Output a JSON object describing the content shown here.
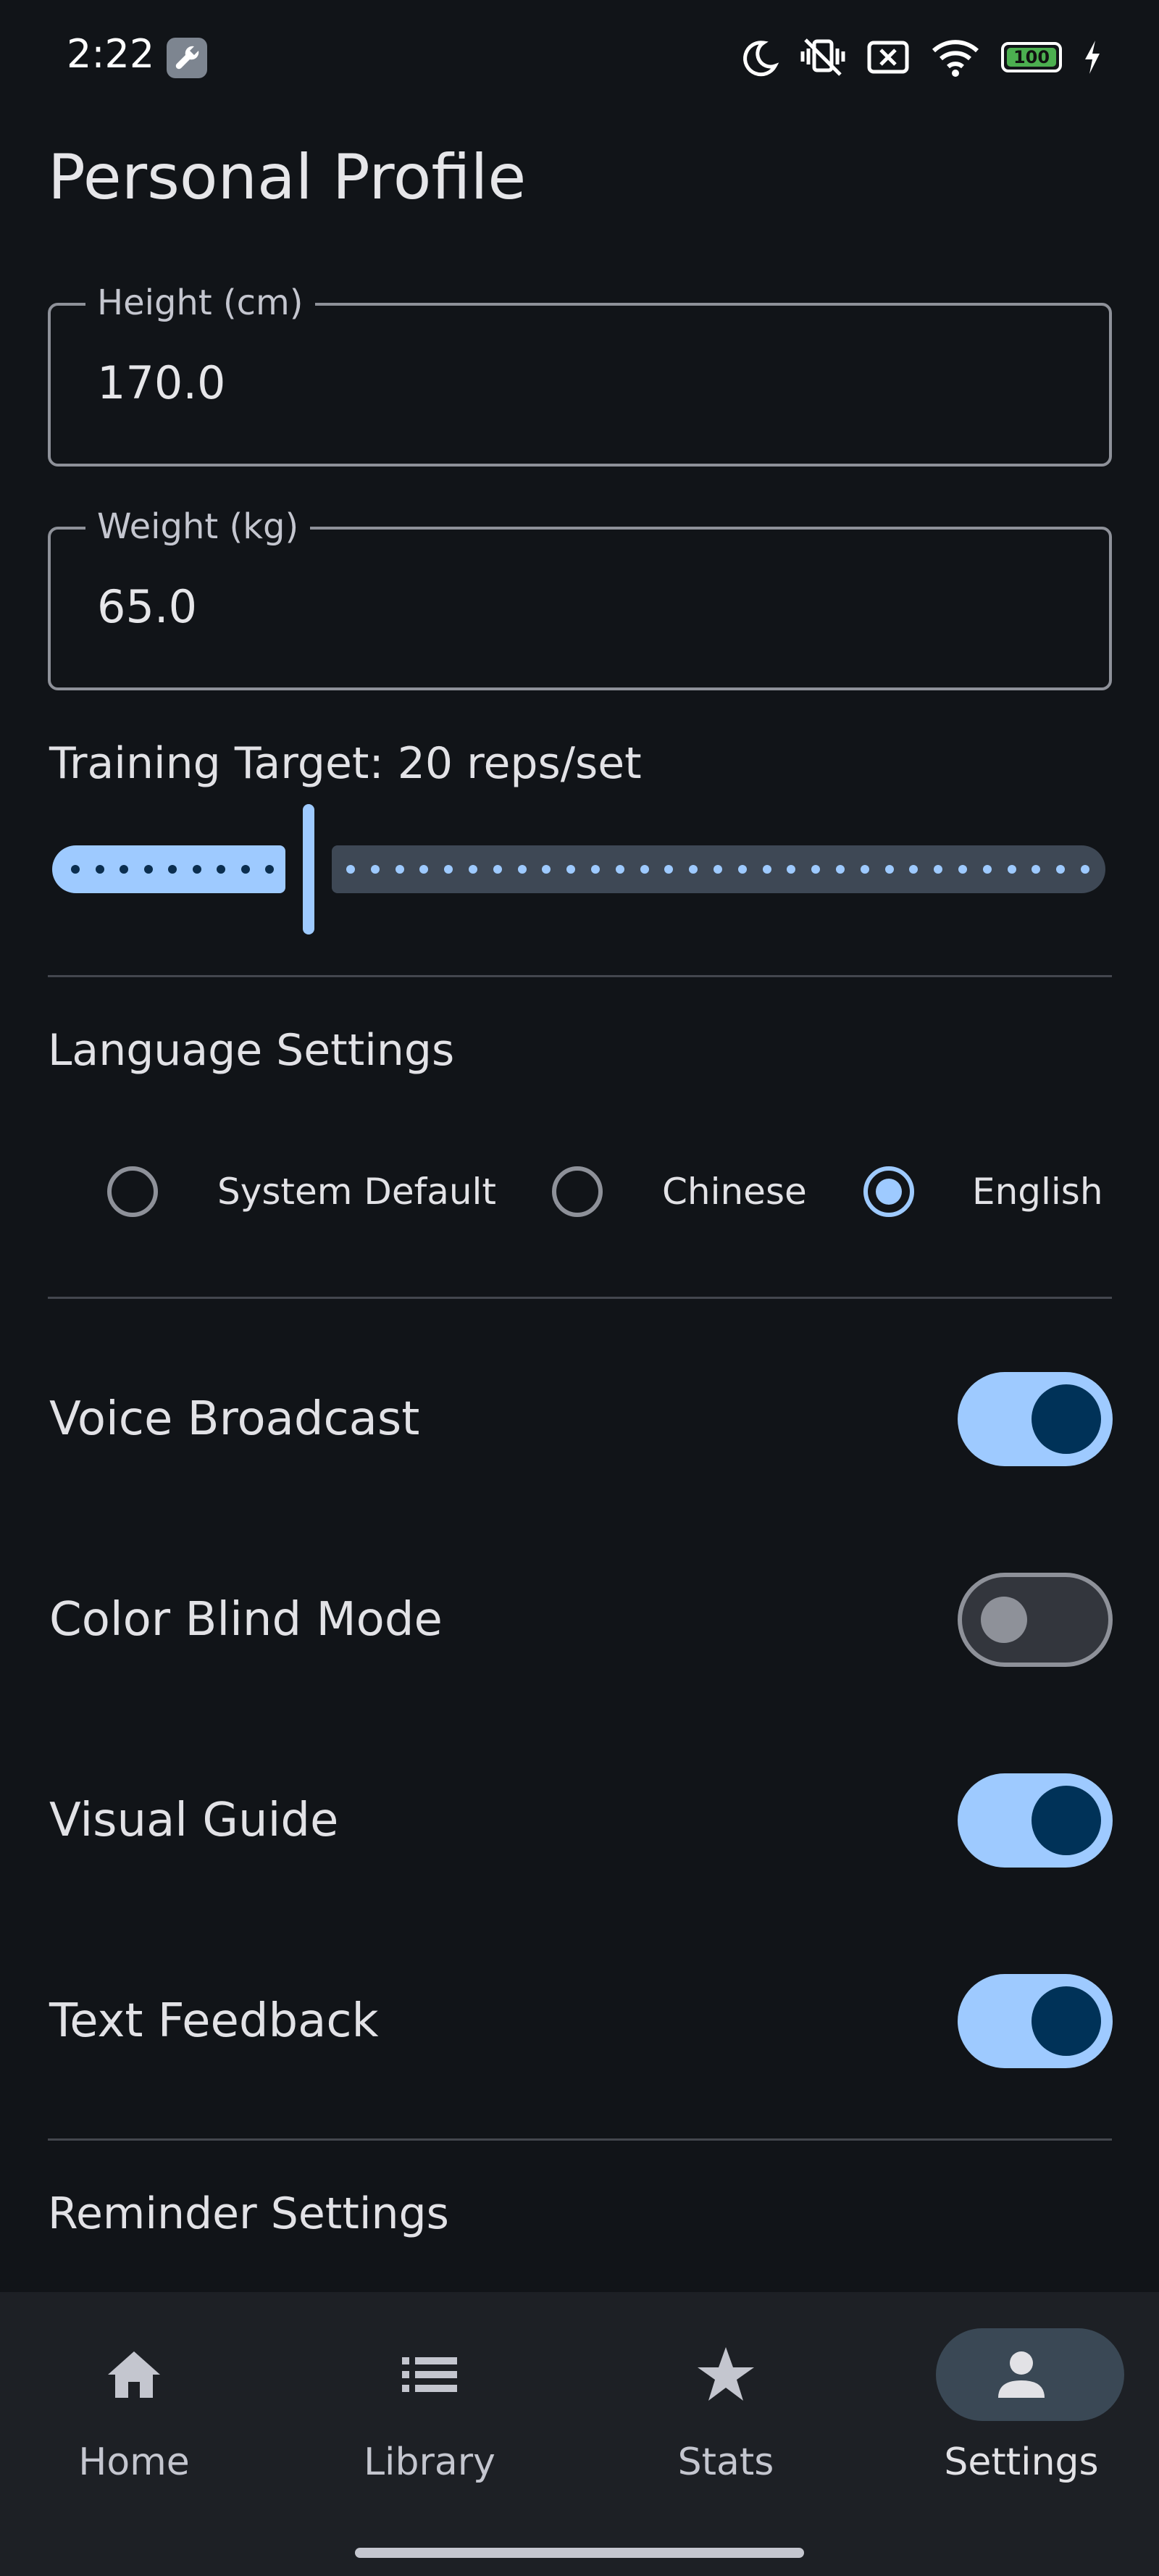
{
  "status_bar": {
    "time": "2:22",
    "battery": "100",
    "icons": [
      "wrench-icon",
      "moon-icon",
      "vibrate-icon",
      "sim-off-icon",
      "wifi-icon",
      "battery-icon",
      "charging-icon"
    ]
  },
  "page_title": "Personal Profile",
  "fields": {
    "height": {
      "label": "Height (cm)",
      "value": "170.0"
    },
    "weight": {
      "label": "Weight (kg)",
      "value": "65.0"
    }
  },
  "training_target": {
    "label": "Training Target: 20 reps/set",
    "value": 20
  },
  "language": {
    "title": "Language Settings",
    "options": [
      {
        "label": "System Default",
        "selected": false
      },
      {
        "label": "Chinese",
        "selected": false
      },
      {
        "label": "English",
        "selected": true
      }
    ]
  },
  "toggles": [
    {
      "label": "Voice Broadcast",
      "on": true
    },
    {
      "label": "Color Blind Mode",
      "on": false
    },
    {
      "label": "Visual Guide",
      "on": true
    },
    {
      "label": "Text Feedback",
      "on": true
    }
  ],
  "reminder": {
    "title": "Reminder Settings"
  },
  "nav": [
    {
      "label": "Home",
      "icon": "home-icon",
      "active": false
    },
    {
      "label": "Library",
      "icon": "list-icon",
      "active": false
    },
    {
      "label": "Stats",
      "icon": "star-icon",
      "active": false
    },
    {
      "label": "Settings",
      "icon": "person-icon",
      "active": true
    }
  ],
  "colors": {
    "background": "#111418",
    "accent": "#9ecaff",
    "knob_on": "#003258"
  }
}
